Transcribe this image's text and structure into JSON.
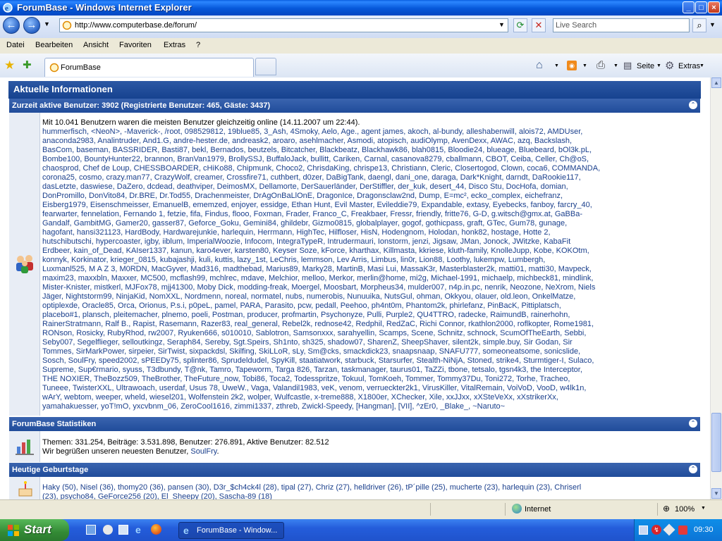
{
  "window": {
    "title": "ForumBase - Windows Internet Explorer",
    "minimize": "_",
    "maximize": "□",
    "close": "×"
  },
  "address_bar": {
    "url": "http://www.computerbase.de/forum/",
    "search_placeholder": "Live Search"
  },
  "menu": [
    "Datei",
    "Bearbeiten",
    "Ansicht",
    "Favoriten",
    "Extras",
    "?"
  ],
  "tabs": {
    "active_label": "ForumBase"
  },
  "toolbar": {
    "seite_label": "Seite",
    "extras_label": "Extras"
  },
  "main_section": {
    "title": "Aktuelle Informationen"
  },
  "active_users": {
    "header": "Zurzeit aktive Benutzer: 3902 (Registrierte Benutzer: 465, Gäste: 3437)",
    "record_line": "Mit 10.041 Benutzern waren die meisten Benutzer gleichzeitig online (14.11.2007 um 22:44).",
    "lines": [
      "hummerfisch, <NeoN>, -Maverick-, /root, 098529812, 19blue85, 3_Ash, 4Smoky, Aelo, Age., agent james, akoch, al-bundy, alleshabenwill, alois72, AMDUser,",
      "anaconda2983, Analintruder, And1.G, andre-hester.de, andreask2, aroaro, asehlmacher, Asmodi, atopisch, audiOlymp, AvenDexx, AWAC, azq, Backslash,",
      "BasCom, baseman, BASSRIDER, Basti87, bekl, Bernados, beutzels, Bitcatcher, Blackbeatz, Blackhawk86, blah0815, Bloodie24, blueage, Bluebeard, bOl3k.pL,",
      "Bombe100, BountyHunter22, brannon, BranVan1979, BrollySSJ, BuffaloJack, bullitt, Cariken, Carnal, casanova8279, cballmann, CBOT, Ceiba, Celler, Ch@oS,",
      "chaosprod, Chef de Loup, CHESSBOARDER, cHiKo88, Chipmunk, Choco2, ChrisdaKing, chrispe13, Christiann, Cleric, Closertogod, Clown, coca6, COMMANDA,",
      "corona25, cosmo, crazy.man77, CrazyWolf, creamer, Crossfire71, cuthbert, d0zer, DaBigTank, daengl, dani_one, daraga, Dark*Knight, darndt, DaRookie117,",
      "dasLetzte, daswiese, DaZero, dcdead, deathviper, DeimosMX, Dellamorte, DerSauerländer, DerStiffler, der_kuk, desert_44, Disco Stu, DocHofa, domian,",
      "DonPromillo, DonVito84, Dr.BRE, Dr.Tod55, Drachenmeister, DrAgOnBaLlOnE, DragonIce, Dragonsclaw2nd, Dump, E=mc², ecko_complex, eichefranz,",
      "Eisberg1979, Eisenschmeisser, EmanuelB, ememzed, enjoyer, essidge, Ethan Hunt, Evil Master, Evileddie79, Expandable, extasy, Eyebecks, fanboy, farcry_40,",
      "fearwarter, fennelation, Fernando 1, fetzie, fifa, Findus, flooo, Foxman, Frader, Franco_C, Freakbaer, Fressr, friendly, fritte76, G-D, g.witsch@gmx.at, GaBBa-",
      "Gandalf, GambitMG, Gamer20, gasser87, Geforce_Goku, Gemini84, ghildebr, Gizmo0815, globalplayer, gogof, gothicpass, graft, GTec, Gum78, gunage,",
      "hagofant, hansi321123, HardBody, Hardwarejunkie, harlequin, Herrmann, HighTec, Hilfloser, HisN, Hodengnom, Holodan, honk82, hostage, Hotte 2,",
      "hutschibutschi, hypercoaster, igby, iiblum, ImperialWoozie, Infocom, IntegraTypeR, Intrudermauri, Ionstorm, jenzi, Jigsaw, JMan, Jonock, JWitzke, KabaFit",
      "Erdbeer, kain_of_Dead, KAIser1337, kanun, karo4ever, karsten80, Keyser Soze, kForce, kharthax, Killmasta, kkriese, kluth-family, KnolleJupp, Kobe, KOKOtm,",
      "konnyk, Korkinator, krieger_0815, kubajashji, kuli, kuttis, lazy_1st, LeChris, lemmson, Lev Arris, Limbus, lin0r, Lion88, Loothy, lukempw, Lumbergh,",
      "Luxmanl525, M A Z 3, M0RDN, MacGyver, Mad316, madthebad, Marius89, Marky28, MartinB, Masi Lui, MassaK3r, Masterblaster2k, matti01, matti30, Mavpeck,",
      "maxim23, maxxbln, Maxxer, MC500, mcflash99, mchlrec, mdave, Melchior, melloo, Merkor, merlin@home, mi2g, Michael-1991, michaelp, michbeck81, mindlink,",
      "Mister-Knister, mistkerl, MJFox78, mjj41300, Moby Dick, modding-freak, Moergel, Moosbart, Morpheus34, mulder007, n4p.in.pc, nenrik, Neozone, NeXrom, Niels",
      "Jäger, Nightstorm99, NinjaKid, NomXXL, Nordmenn, noreal, normatel, nubs, numerobis, Nunuuika, NutsGul, ohman, Okkyou, olauer, old.leon, OnkelMatze,",
      "optiplexde, Oracle85, Orca, Orionus, P.s.i, p0peL, pamel, PARA, Parasito, pcw, pedall, Peehoo, ph4nt0m, Phantom2k, phirlefanz, PinBacK, Pittiplatsch,",
      "placebo#1, plansch, pleitemacher, plnemo, poeli, Postman, producer, profmartin, Psychonyze, Pulli, Purple2, QU4TTRO, radecke, RaimundB, rainerhohn,",
      "RainerStratmann, Ralf B., Rapist, Rasemann, Razer83, real_general, Rebel2k, rednose42, Redphil, RedZaC, Richi Connor, rkathlon2000, roflkopter, Rome1981,",
      "RONson, Rosicky, RubyRhod, rw2007, Ryuken666, s010010, Sablotron, Samsonxxx, sarahyellin, Scamps, Scene, Schnitz, schnock, ScumOfTheEarth, Sebbi,",
      "Seby007, Segelflieger, selloutkingz, Seraph84, Sereby, Sgt.Speirs, Sh1nto, sh325, shadow07, SharenZ, SheepShaver, silent2k, simple.buy, Sir Godan, Sir",
      "Tommes, SirMarkPower, sirpeier, SirTwist, sixpackdsl, Skilfing, SkiLLoR, sLy, Sm@cks, smackdick23, snaapsnaap, SNAFU777, someoneatsome, sonicslide,",
      "Sosch, SoulFry, speed2002, sPEEDy75, splinter86, Sprudeldudel, SpyKill, staatiatwork, starbuck, Starsurfer, Stealth-NiNjA, Stoned, strike4, Sturmtiger-I, Sulaco,",
      "Supreme, Sup€rmario, syuss, T3dbundy, T@nk, Tamro, Tapeworm, Targa 826, Tarzan, taskmanager, taurus01, TaZZi, tbone, tetsalo, tgsn4k3, the Interceptor,",
      "THE NOXIER, TheBozz509, TheBrother, TheFuture_now, Tobi86, Toca2, Todesspritze, Tokuul, TomKoeh, Tommer, Tommy37Du, Toni272, Torhe, Tracheo,",
      "Tuneee, TwisterXXL, Ultrawoach, userdaf, Usus 78, UweW., Vaga, Valandil1983, veK, venom, verrueckter2k1, VirusKiller, VitalRemain, VoiVoD, VooD, w4lk1n,",
      "wArY, webtom, weeper, wheld, wiesel201, Wolfenstein 2k2, wolper, Wulfcastle, x-treme888, X1800er, XChecker, Xile, xxJJxx, xXSteVeXx, xXstrikerXx,",
      "yamahakuesser, yoT!mO, yxcvbnm_06, ZeroCool1616, zimmi1337, zthreb, Zwickl-Speedy, [Hangman], [VII], ^zEr0, _Blake_, ~Naruto~"
    ]
  },
  "statistics": {
    "header": "ForumBase Statistiken",
    "line1": "Themen: 331.254, Beiträge: 3.531.898, Benutzer: 276.891, Aktive Benutzer: 82.512",
    "line2_prefix": "Wir begrüßen unseren neuesten Benutzer, ",
    "line2_user": "SoulFry",
    "line2_suffix": "."
  },
  "birthdays": {
    "header": "Heutige Geburtstage",
    "line1": "Haky (50), Nisel (36), thomy20 (36), pansen (30), D3r_$ch4ck4l (28), tipal (27), Chriz (27), helldriver (26), tP´pille (25), mucherte (23), harlequin (23), Chriserl",
    "line2": "(23), psycho84, GeForce256 (20), El_Sheepy (20), Sascha-89 (18)"
  },
  "status_bar": {
    "zone": "Internet",
    "zoom": "100%"
  },
  "taskbar": {
    "start": "Start",
    "task_label": "ForumBase - Window...",
    "clock": "09:30"
  },
  "colors": {
    "header_blue": "#16428f",
    "section_blue": "#204c9a",
    "link_blue": "#1a3f8c",
    "xp_taskbar": "#245ddb"
  }
}
